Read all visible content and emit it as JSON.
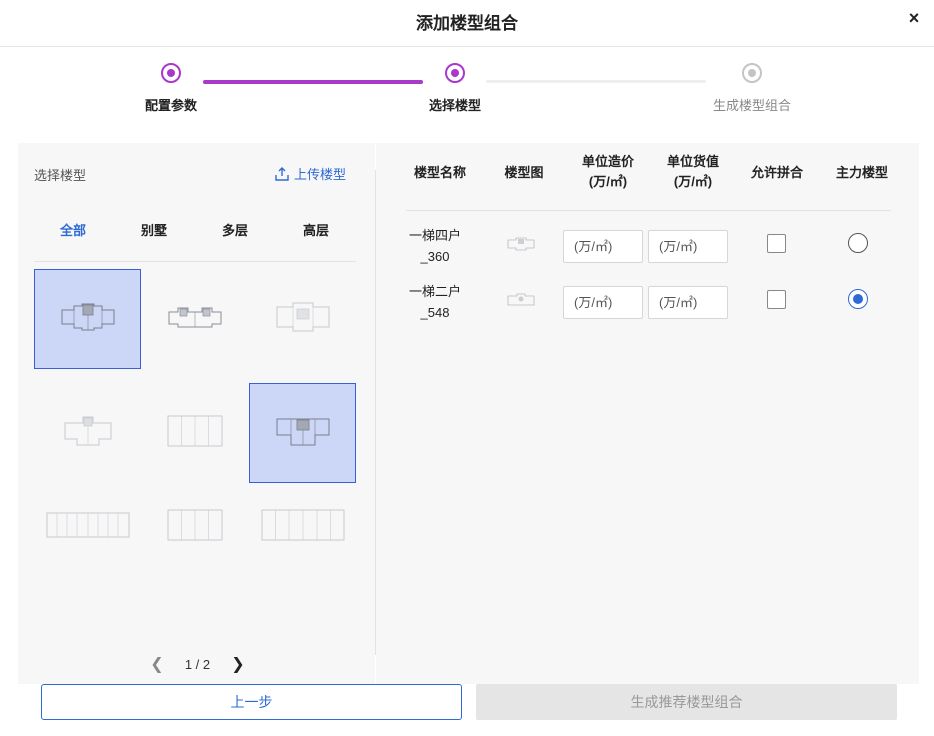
{
  "dialog": {
    "title": "添加楼型组合",
    "close_label": "×"
  },
  "steps": [
    {
      "label": "配置参数",
      "state": "done"
    },
    {
      "label": "选择楼型",
      "state": "current"
    },
    {
      "label": "生成楼型组合",
      "state": "pending"
    }
  ],
  "left_panel": {
    "title": "选择楼型",
    "upload_label": "上传楼型",
    "filters": [
      "全部",
      "别墅",
      "多层",
      "高层"
    ],
    "active_filter": "全部",
    "thumbnails": [
      {
        "icon": "floor-plan-icon",
        "selected": true
      },
      {
        "icon": "floor-plan-icon",
        "selected": false
      },
      {
        "icon": "floor-plan-icon",
        "selected": false
      },
      {
        "icon": "floor-plan-icon",
        "selected": false
      },
      {
        "icon": "floor-plan-icon",
        "selected": false
      },
      {
        "icon": "floor-plan-icon",
        "selected": true
      },
      {
        "icon": "floor-plan-icon",
        "selected": false
      },
      {
        "icon": "floor-plan-icon",
        "selected": false
      },
      {
        "icon": "floor-plan-icon",
        "selected": false
      }
    ],
    "pagination": {
      "text": "1 / 2",
      "current": 1,
      "total": 2
    }
  },
  "table": {
    "headers": {
      "name": "楼型名称",
      "plan": "楼型图",
      "cost": "单位造价",
      "cost_unit": "(万/㎡)",
      "value": "单位货值",
      "value_unit": "(万/㎡)",
      "allow_combine": "允许拼合",
      "main_type": "主力楼型"
    },
    "rows": [
      {
        "name_line1": "一梯四户",
        "name_line2": "_360",
        "cost_placeholder": "(万/㎡)",
        "value_placeholder": "(万/㎡)",
        "allow_combine": false,
        "main": false
      },
      {
        "name_line1": "一梯二户",
        "name_line2": "_548",
        "cost_placeholder": "(万/㎡)",
        "value_placeholder": "(万/㎡)",
        "allow_combine": false,
        "main": true
      }
    ]
  },
  "footer": {
    "prev_label": "上一步",
    "generate_label": "生成推荐楼型组合"
  },
  "colors": {
    "accent_purple": "#a839c9",
    "link_blue": "#2e6ad6",
    "selected_bg": "#ccd6f7"
  }
}
